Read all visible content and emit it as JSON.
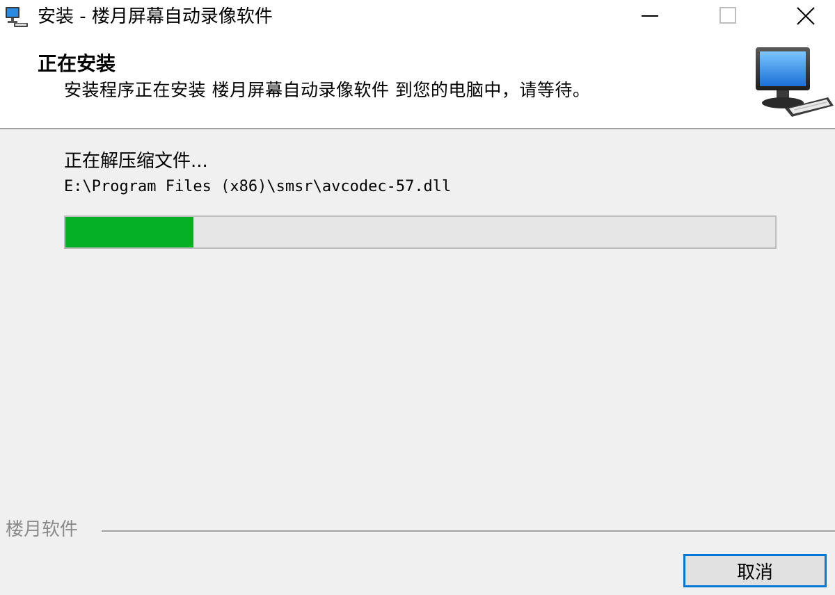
{
  "window": {
    "title": "安装 - 楼月屏幕自动录像软件",
    "app_icon": "computer-icon",
    "controls": {
      "minimize_icon": "minimize-icon",
      "maximize_icon": "maximize-icon",
      "close_icon": "close-icon"
    }
  },
  "header": {
    "title": "正在安装",
    "subtitle": "安装程序正在安装 楼月屏幕自动录像软件 到您的电脑中，请等待。",
    "icon": "computer-keyboard-icon"
  },
  "main": {
    "status": "正在解压缩文件...",
    "current_file": "E:\\Program Files (x86)\\smsr\\avcodec-57.dll",
    "progress": 0.18
  },
  "footer": {
    "brand": "楼月软件",
    "cancel_label": "取消"
  },
  "colors": {
    "progress_fill": "#06b025",
    "progress_track": "#e6e6e6",
    "button_focus_border": "#0078d7",
    "brand_text": "#8a8a8a"
  }
}
